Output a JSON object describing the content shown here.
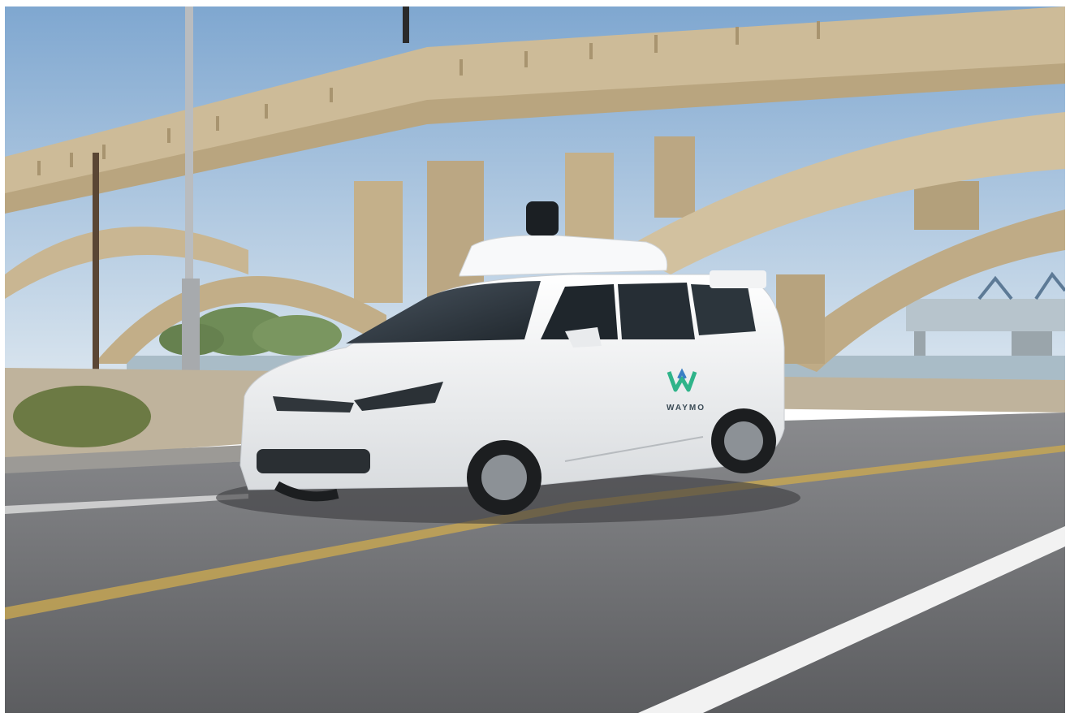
{
  "photo": {
    "subject": "self-driving-minivan-under-arched-bridge",
    "logo_text": "WAYMO",
    "colors": {
      "sky_top": "#7fa7d0",
      "sky_bottom": "#d6e3ee",
      "bridge": "#cdbb98",
      "bridge_shadow": "#a8946f",
      "road": "#6f7073",
      "vehicle_body": "#f4f5f6",
      "logo_green": "#2fb48a",
      "logo_blue": "#3a7fc4"
    },
    "icons": [
      "waymo-logo-icon",
      "lidar-dome-icon"
    ]
  }
}
